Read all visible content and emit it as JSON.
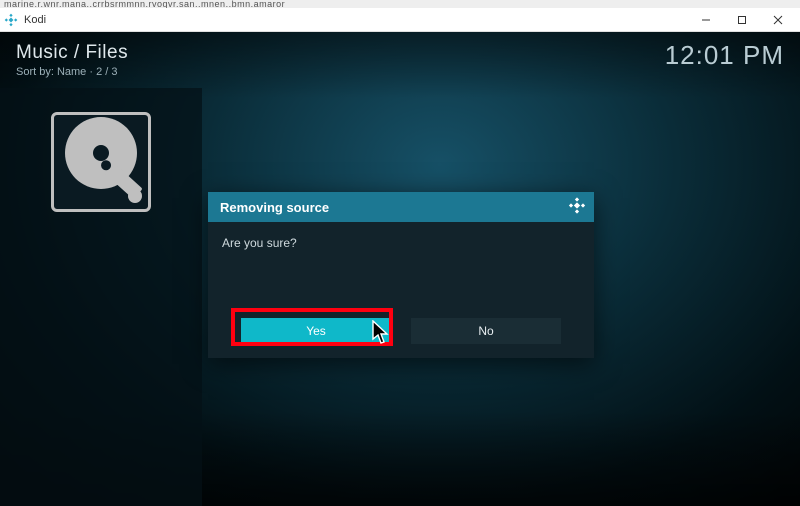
{
  "window": {
    "garbled_text": "marine.r.wnr.mana..crrbsrmmnn.rvoqvr.san..mnen..bmn.amaror",
    "title": "Kodi"
  },
  "header": {
    "breadcrumb": "Music / Files",
    "sort_label": "Sort by: Name",
    "pager": "2 / 3",
    "clock": "12:01 PM"
  },
  "dialog": {
    "title": "Removing source",
    "message": "Are you sure?",
    "yes_label": "Yes",
    "no_label": "No"
  },
  "annotation": {
    "highlight_target": "yes-button"
  }
}
